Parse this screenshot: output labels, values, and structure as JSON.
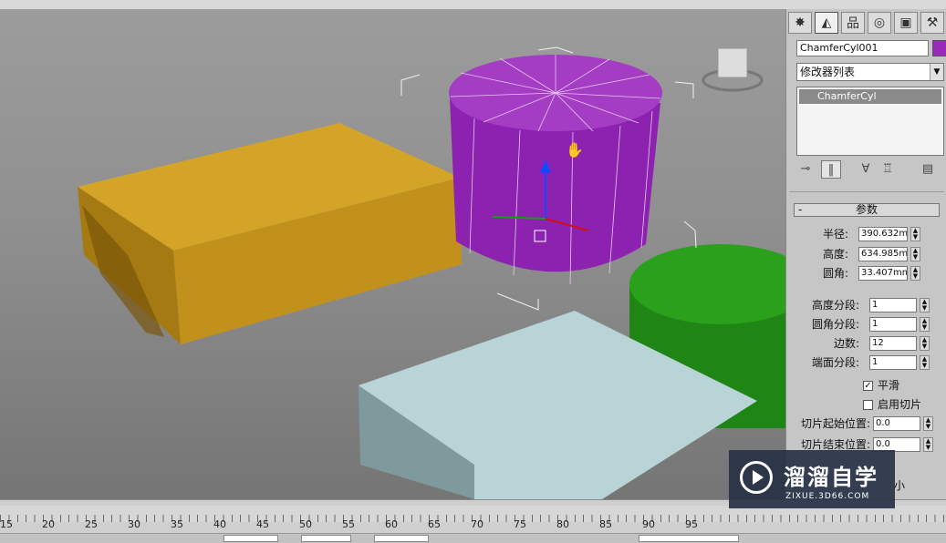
{
  "object": {
    "name": "ChamferCyl001",
    "color": "#9a2bb8"
  },
  "modifier_list": {
    "label": "修改器列表"
  },
  "modifier_stack": {
    "items": [
      "ChamferCyl"
    ]
  },
  "panel_tabs": [
    "create-icon",
    "modify-icon",
    "hierarchy-icon",
    "motion-icon",
    "display-icon",
    "utilities-icon"
  ],
  "params": {
    "title": "参数",
    "radius_label": "半径:",
    "radius": "390.632m",
    "height_label": "高度:",
    "height": "634.985m",
    "fillet_label": "圆角:",
    "fillet": "33.407mm",
    "height_segs_label": "高度分段:",
    "height_segs": "1",
    "fillet_segs_label": "圆角分段:",
    "fillet_segs": "1",
    "sides_label": "边数:",
    "sides": "12",
    "cap_segs_label": "端面分段:",
    "cap_segs": "1",
    "smooth_label": "平滑",
    "smooth": true,
    "slice_on_label": "启用切片",
    "slice_on": false,
    "slice_from_label": "切片起始位置:",
    "slice_from": "0.0",
    "slice_to_label": "切片结束位置:",
    "slice_to": "0.0",
    "partial_label": "小"
  },
  "timeline": {
    "ticks": [
      "15",
      "20",
      "25",
      "30",
      "35",
      "40",
      "45",
      "50",
      "55",
      "60",
      "65",
      "70",
      "75",
      "80",
      "85",
      "90",
      "95"
    ]
  },
  "watermark": {
    "title": "溜溜自学",
    "url": "ZIXUE.3D66.COM"
  },
  "colors": {
    "box_gold": "#c99a1f",
    "cylinder_purple": "#9a2bb8",
    "cylinder_green": "#1e8a12",
    "box_cyan": "#b5d2d4"
  }
}
